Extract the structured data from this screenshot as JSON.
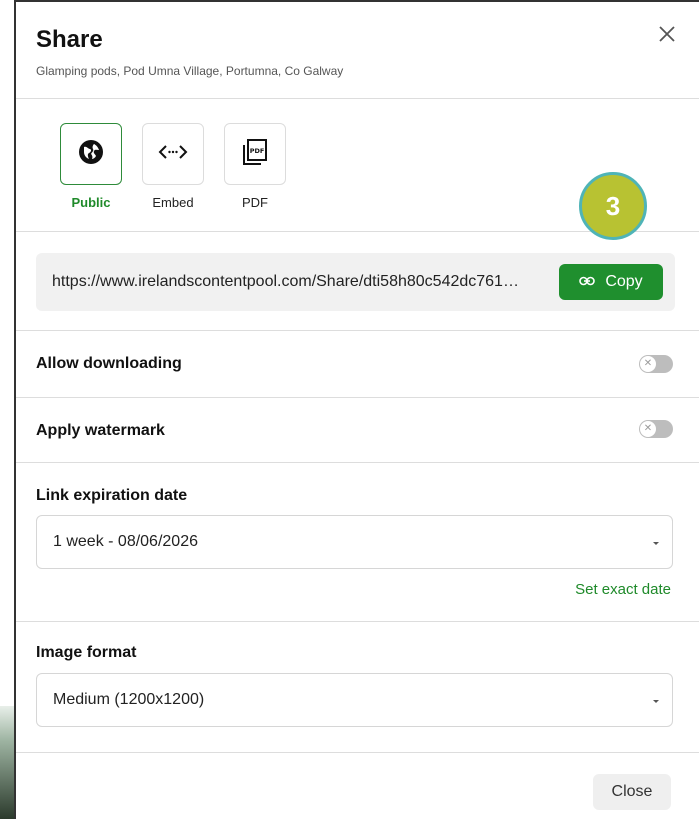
{
  "header": {
    "title": "Share",
    "subtitle": "Glamping pods, Pod Umna Village, Portumna, Co Galway"
  },
  "share_options": [
    {
      "label": "Public",
      "icon": "globe-icon",
      "active": true
    },
    {
      "label": "Embed",
      "icon": "code-icon",
      "active": false
    },
    {
      "label": "PDF",
      "icon": "pdf-icon",
      "active": false
    }
  ],
  "badge": {
    "number": "3",
    "color": "#b8c232",
    "border": "#4fb4b7"
  },
  "share_link": {
    "url": "https://www.irelandscontentpool.com/Share/dti58h80c542dc761…",
    "copy_label": "Copy"
  },
  "settings": {
    "allow_downloading": {
      "label": "Allow downloading",
      "enabled": false
    },
    "apply_watermark": {
      "label": "Apply watermark",
      "enabled": false
    }
  },
  "expiration": {
    "label": "Link expiration date",
    "selected": "1 week - 08/06/2026",
    "exact_date_link": "Set exact date"
  },
  "image_format": {
    "label": "Image format",
    "selected": "Medium (1200x1200)"
  },
  "footer": {
    "close_label": "Close"
  },
  "colors": {
    "accent": "#1f8f2e",
    "text": "#111111",
    "muted": "#555555"
  }
}
